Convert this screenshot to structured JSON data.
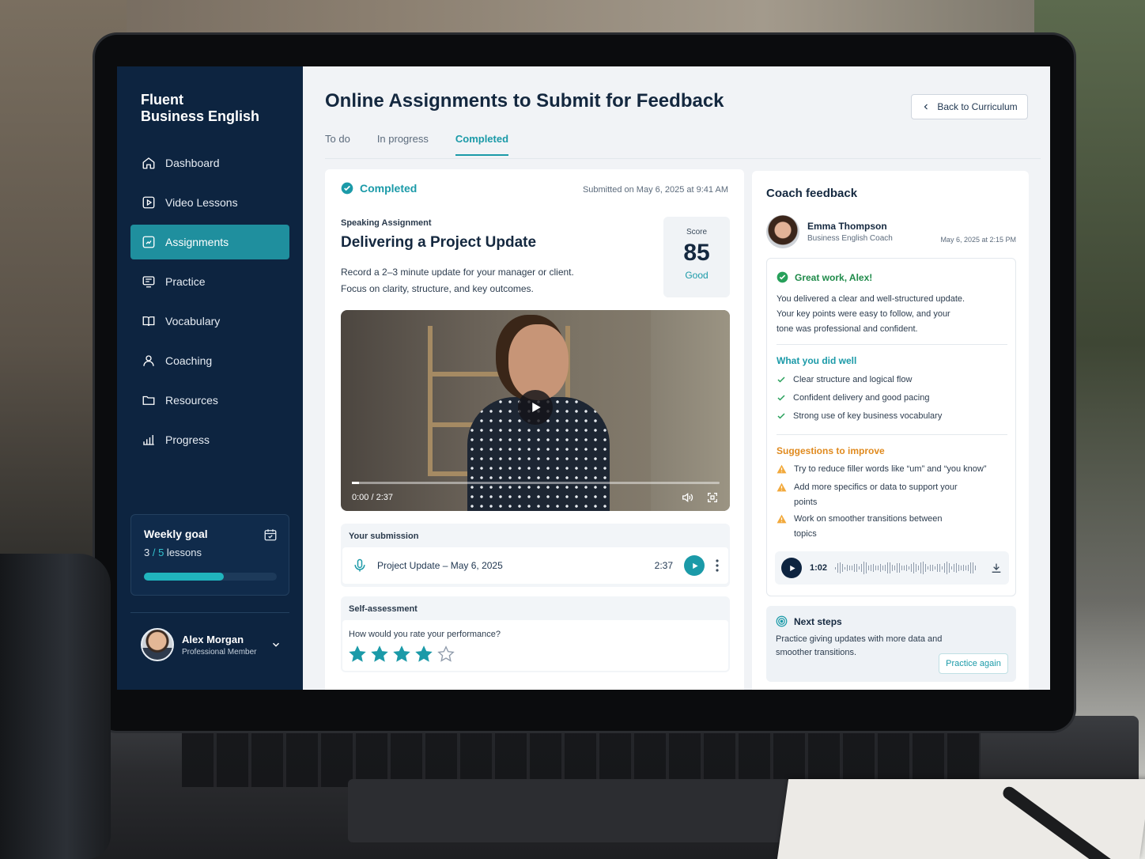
{
  "brand": {
    "line1": "Fluent",
    "line2": "Business English"
  },
  "nav": [
    {
      "label": "Dashboard",
      "icon": "home-icon"
    },
    {
      "label": "Video Lessons",
      "icon": "video-icon"
    },
    {
      "label": "Assignments",
      "icon": "assignment-icon",
      "active": true
    },
    {
      "label": "Practice",
      "icon": "practice-icon"
    },
    {
      "label": "Vocabulary",
      "icon": "book-icon"
    },
    {
      "label": "Coaching",
      "icon": "user-icon"
    },
    {
      "label": "Resources",
      "icon": "folder-icon"
    },
    {
      "label": "Progress",
      "icon": "bar-chart-icon"
    }
  ],
  "weekly_goal": {
    "title": "Weekly goal",
    "done": "3",
    "slash": " / ",
    "total": "5",
    "unit": " lessons",
    "progress": 0.6
  },
  "user": {
    "name": "Alex Morgan",
    "role": "Professional Member"
  },
  "page": {
    "title": "Online Assignments to Submit for Feedback",
    "back_label": "Back to Curriculum"
  },
  "tabs": [
    {
      "label": "To do"
    },
    {
      "label": "In progress"
    },
    {
      "label": "Completed",
      "active": true
    }
  ],
  "assignment": {
    "status": "Completed",
    "submitted": "Submitted on May 6, 2025  at  9:41 AM",
    "kind": "Speaking Assignment",
    "title": "Delivering a Project Update",
    "desc_line1": "Record a 2–3 minute update for your manager or client.",
    "desc_line2": "Focus on clarity, structure, and key outcomes.",
    "score_label": "Score",
    "score_value": "85",
    "score_grade": "Good",
    "video_time": "0:00 / 2:37",
    "video_progress": 0.02
  },
  "submission": {
    "heading": "Your submission",
    "file": "Project Update – May 6, 2025",
    "duration": "2:37"
  },
  "self_assessment": {
    "heading": "Self-assessment",
    "question": "How would you rate your performance?",
    "rating": 4,
    "max": 5
  },
  "feedback": {
    "title": "Coach feedback",
    "coach_name": "Emma Thompson",
    "coach_role": "Business English Coach",
    "date": "May 6, 2025 at 2:15 PM",
    "greeting": "Great work, Alex!",
    "summary_1": "You delivered a clear and well-structured update.",
    "summary_2": "Your key points were easy to follow, and your",
    "summary_3": "tone was professional and confident.",
    "well_heading": "What you did well",
    "well": [
      "Clear structure and logical flow",
      "Confident delivery and good pacing",
      "Strong use of key business vocabulary"
    ],
    "improve_heading": "Suggestions to improve",
    "improve": [
      "Try to reduce filler words like “um” and “you know”",
      "Add more specifics or data to support your points",
      "Work on smoother transitions between topics"
    ],
    "audio_time": "1:02"
  },
  "next_steps": {
    "heading": "Next steps",
    "text": "Practice giving updates with more data and smoother transitions.",
    "button": "Practice again"
  },
  "colors": {
    "sidebar": "#0d2440",
    "accent": "#1b9aa8",
    "success": "#1e8a49",
    "warning": "#e08a1e"
  }
}
